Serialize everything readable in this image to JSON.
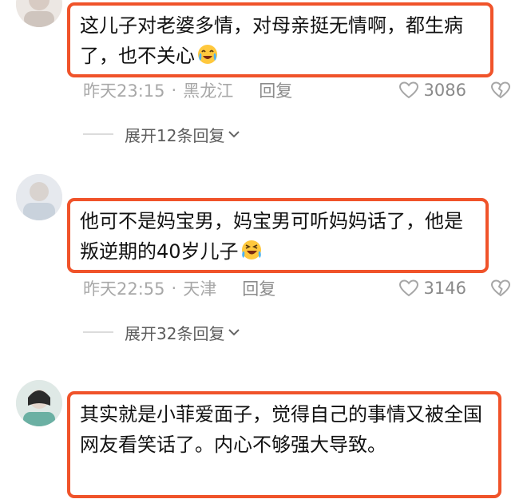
{
  "comments": [
    {
      "text": "这儿子对老婆多情，对母亲挺无情啊，都生病了，也不关心",
      "emoji": "laughing-crying-emoji",
      "time": "昨天23:15",
      "location": "黑龙江",
      "reply_label": "回复",
      "likes": "3086",
      "expand_label": "展开12条回复"
    },
    {
      "text": "他可不是妈宝男，妈宝男可听妈妈话了，他是叛逆期的40岁儿子",
      "emoji": "rolling-laughing-emoji",
      "time": "昨天22:55",
      "location": "天津",
      "reply_label": "回复",
      "likes": "3146",
      "expand_label": "展开32条回复"
    },
    {
      "text": "其实就是小菲爱面子，觉得自己的事情又被全国网友看笑话了。内心不够强大导致。"
    }
  ],
  "meta_separator": "·",
  "colors": {
    "highlight_border": "#f0532a",
    "meta_text": "#a8a8a8",
    "divider": "#dcdcdc"
  }
}
